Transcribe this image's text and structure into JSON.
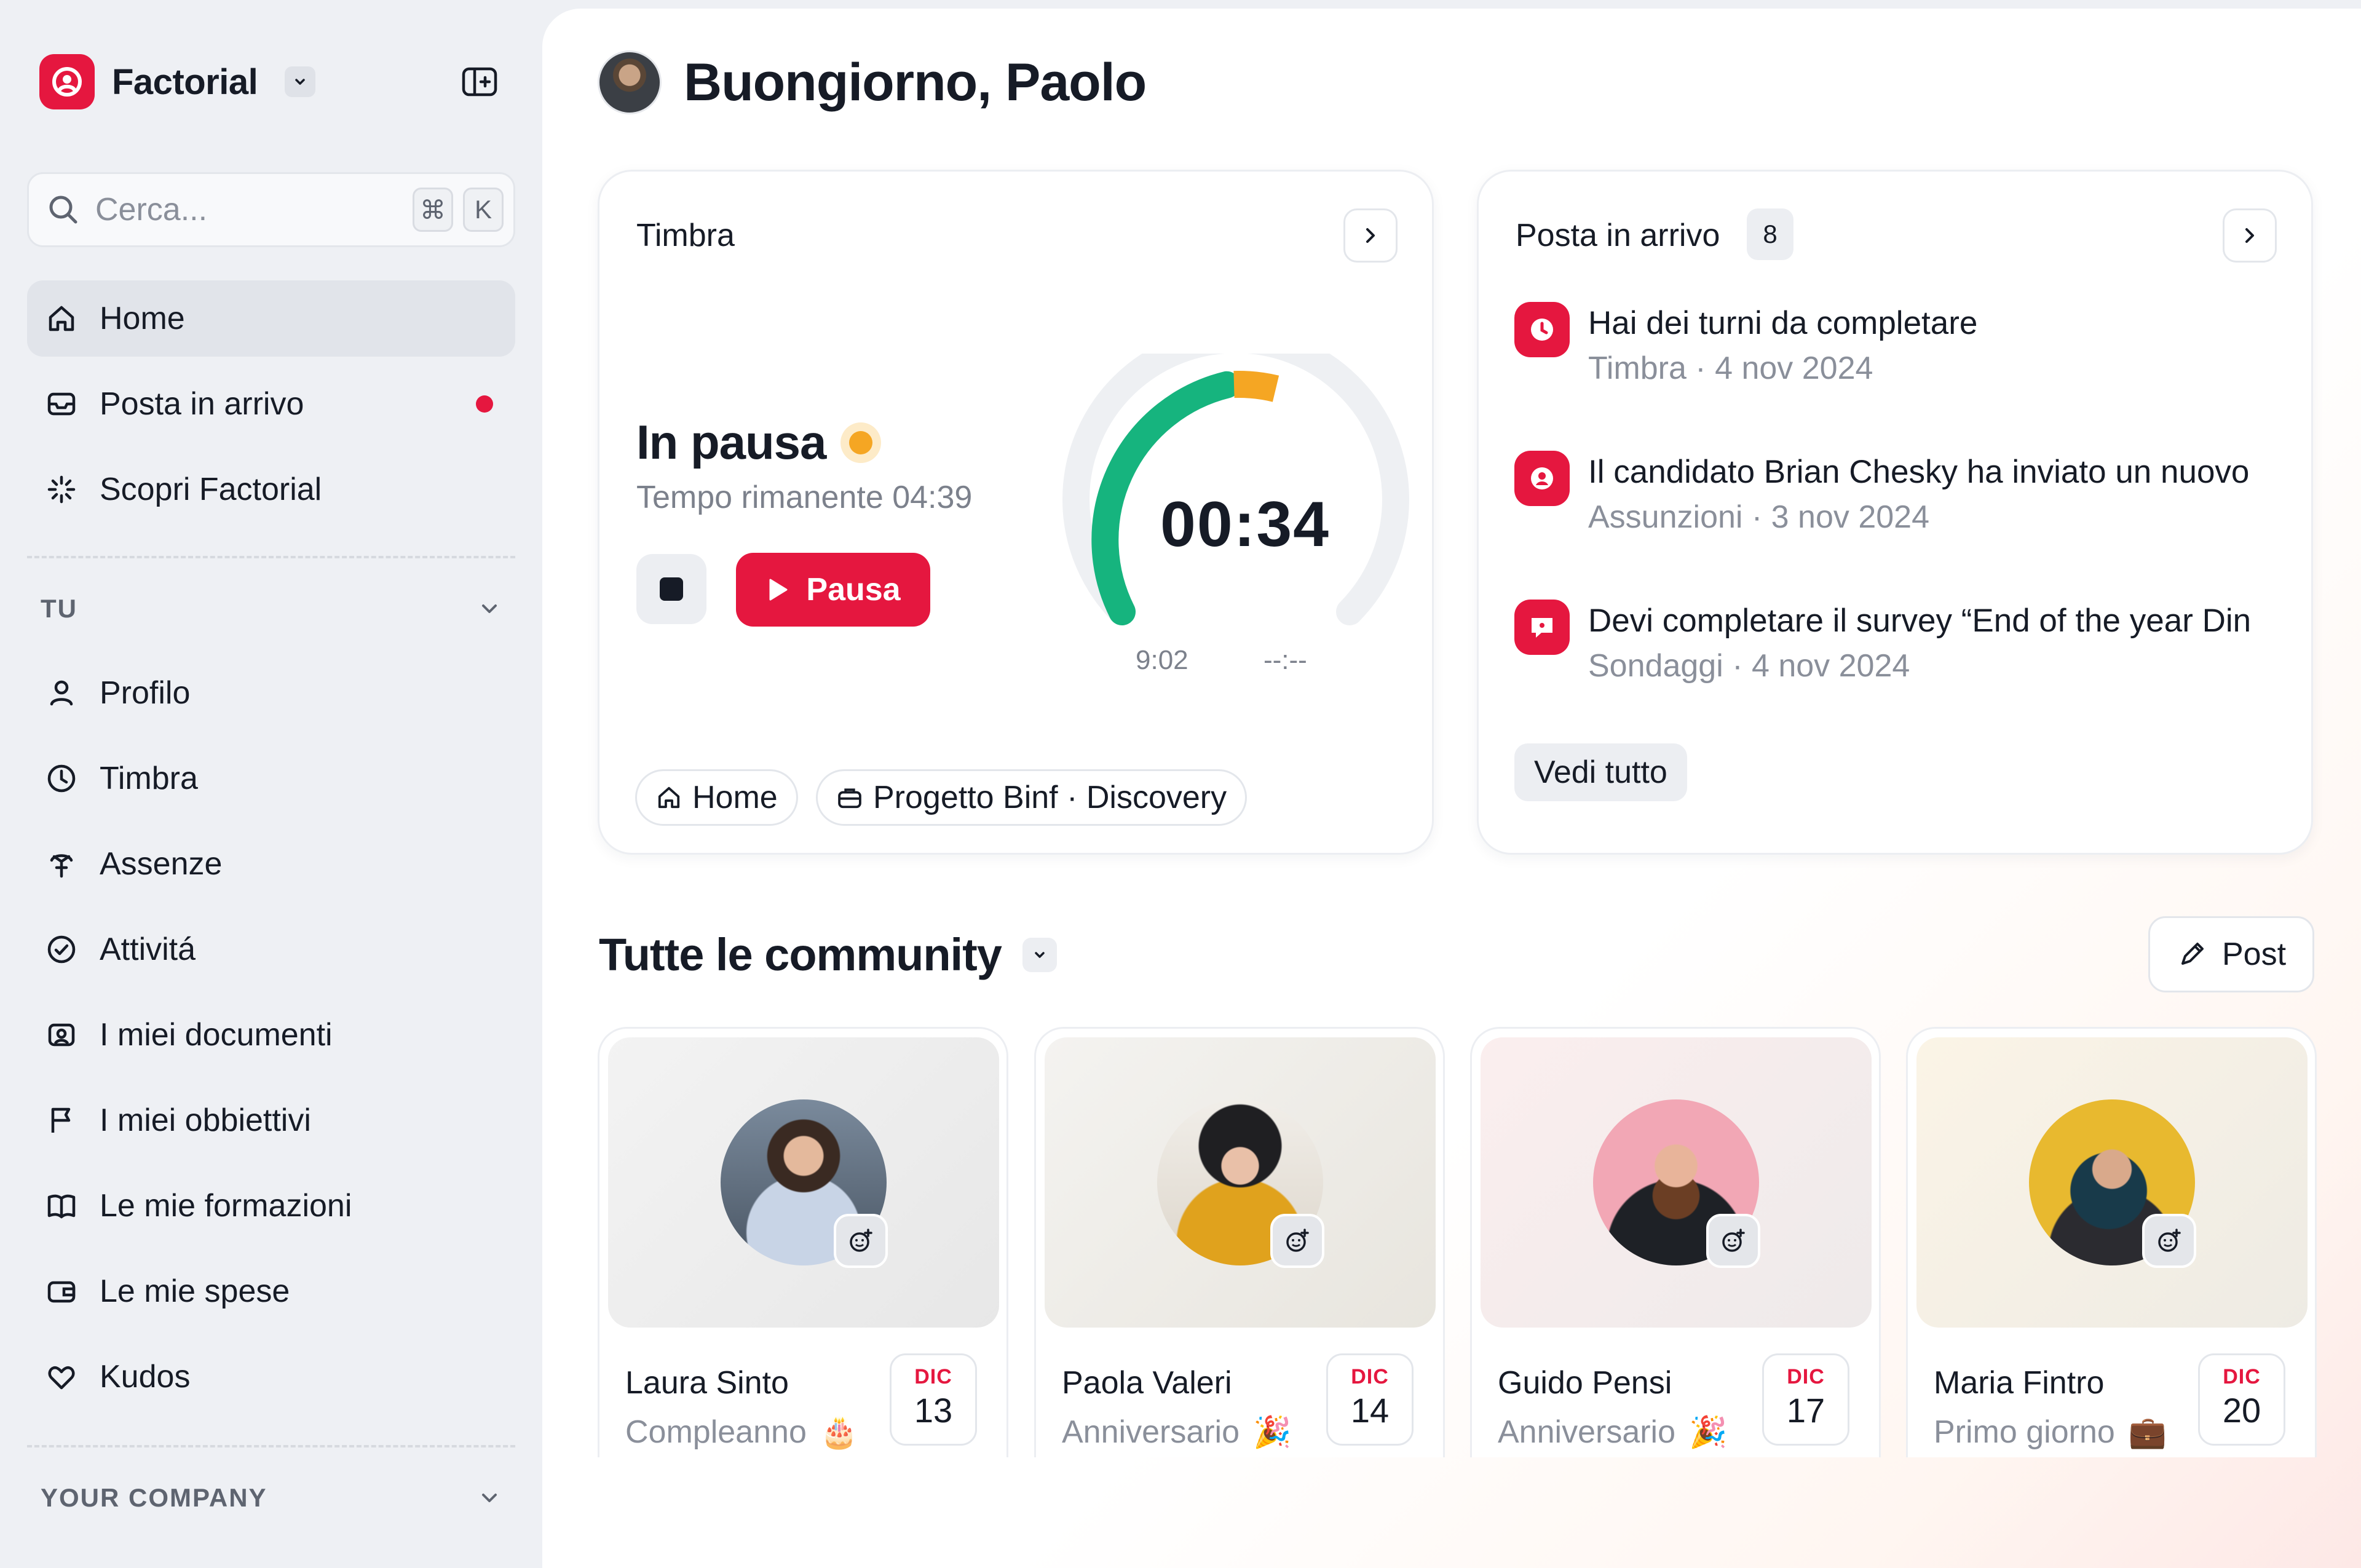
{
  "sidebar": {
    "brand": "Factorial",
    "search": {
      "placeholder": "Cerca...",
      "shortcut_cmd": "⌘",
      "shortcut_key": "K"
    },
    "nav": [
      {
        "label": "Home",
        "icon": "home-icon",
        "active": true
      },
      {
        "label": "Posta in arrivo",
        "icon": "inbox-icon",
        "notification": true
      },
      {
        "label": "Scopri Factorial",
        "icon": "sparkle-icon"
      }
    ],
    "section_tu": "TU",
    "tu_items": [
      {
        "label": "Profilo",
        "icon": "user-icon"
      },
      {
        "label": "Timbra",
        "icon": "clock-icon"
      },
      {
        "label": "Assenze",
        "icon": "palm-tree-icon"
      },
      {
        "label": "Attivitá",
        "icon": "check-circle-icon"
      },
      {
        "label": "I miei documenti",
        "icon": "document-icon"
      },
      {
        "label": "I miei obbiettivi",
        "icon": "flag-icon"
      },
      {
        "label": "Le mie formazioni",
        "icon": "book-icon"
      },
      {
        "label": "Le mie spese",
        "icon": "wallet-icon"
      },
      {
        "label": "Kudos",
        "icon": "heart-icon"
      }
    ],
    "section_company": "YOUR COMPANY"
  },
  "greeting": "Buongiorno, Paolo",
  "clock": {
    "title": "Timbra",
    "status": "In pausa",
    "remaining": "Tempo rimanente 04:39",
    "pause_button": "Pausa",
    "timer": "00:34",
    "start_time": "9:02",
    "end_time": "--:--",
    "tags": [
      "Home",
      "Progetto Binf · Discovery"
    ],
    "colors": {
      "progress": "#16b47e",
      "pause": "#f5a623",
      "track": "#eef0f3"
    }
  },
  "inbox": {
    "title": "Posta in arrivo",
    "count": "8",
    "items": [
      {
        "title": "Hai dei turni da completare",
        "meta": "Timbra  ·  4 nov 2024",
        "icon": "clock-icon"
      },
      {
        "title": "Il candidato Brian Chesky ha inviato un nuovo",
        "meta": "Assunzioni  ·  3 nov 2024",
        "icon": "candidate-icon"
      },
      {
        "title": "Devi completare il survey “End of the year Din",
        "meta": "Sondaggi  ·  4 nov 2024",
        "icon": "survey-icon"
      }
    ],
    "see_all": "Vedi tutto"
  },
  "community": {
    "title": "Tutte le community",
    "post_button": "Post",
    "people": [
      {
        "name": "Laura Sinto",
        "event": "Compleanno",
        "emoji": "🎂",
        "month": "DIC",
        "day": "13"
      },
      {
        "name": "Paola Valeri",
        "event": "Anniversario",
        "emoji": "🎉",
        "month": "DIC",
        "day": "14"
      },
      {
        "name": "Guido Pensi",
        "event": "Anniversario",
        "emoji": "🎉",
        "month": "DIC",
        "day": "17"
      },
      {
        "name": "Maria Fintro",
        "event": "Primo giorno",
        "emoji": "💼",
        "month": "DIC",
        "day": "20"
      }
    ]
  },
  "brand_color": "#e5173f"
}
